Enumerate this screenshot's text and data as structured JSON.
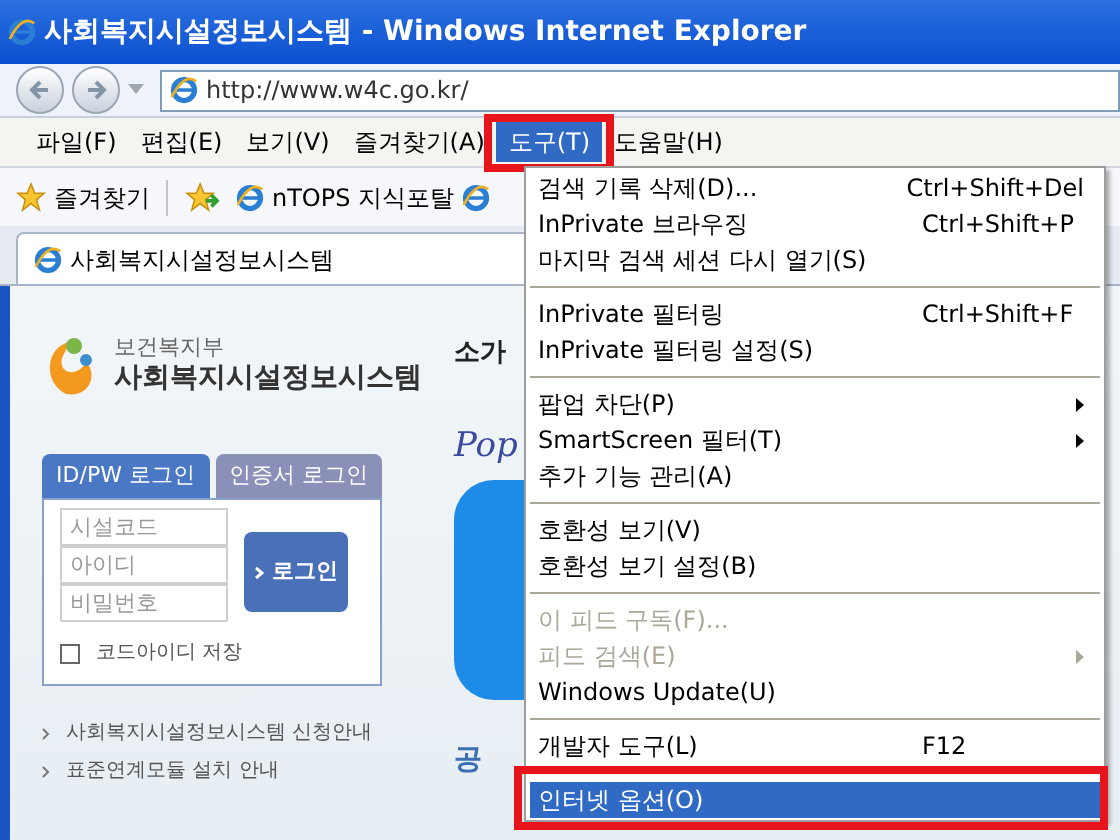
{
  "window": {
    "title": "사회복지시설정보시스템 - Windows Internet Explorer"
  },
  "address_bar": {
    "url": "http://www.w4c.go.kr/"
  },
  "menu_bar": [
    {
      "label": "파일(F)",
      "selected": false,
      "annotated": false
    },
    {
      "label": "편집(E)",
      "selected": false,
      "annotated": false
    },
    {
      "label": "보기(V)",
      "selected": false,
      "annotated": false
    },
    {
      "label": "즐겨찾기(A)",
      "selected": false,
      "annotated": false
    },
    {
      "label": "도구(T)",
      "selected": true,
      "annotated": true
    },
    {
      "label": "도움말(H)",
      "selected": false,
      "annotated": false
    }
  ],
  "favorites_bar": {
    "favorites_button": "즐겨찾기",
    "links": [
      "nTOPS 지식포탈"
    ]
  },
  "tab": {
    "title": "사회복지시설정보시스템"
  },
  "page": {
    "ministry": "보건복지부",
    "site_name": "사회복지시설정보시스템",
    "login": {
      "tabs": [
        {
          "label": "ID/PW 로그인",
          "selected": true
        },
        {
          "label": "인증서 로그인",
          "selected": false
        }
      ],
      "fields": [
        {
          "placeholder": "시설코드"
        },
        {
          "placeholder": "아이디"
        },
        {
          "placeholder": "비밀번호"
        }
      ],
      "button": "로그인",
      "remember": {
        "label": "코드아이디 저장",
        "checked": false
      }
    },
    "links": [
      "사회복지시설정보시스템 신청안내",
      "표준연계모듈 설치 안내"
    ],
    "heading_partial": "소가",
    "popup_partial": "Pop",
    "notice_partial": "공"
  },
  "tools_menu": {
    "groups": [
      [
        {
          "label": "검색 기록 삭제(D)...",
          "shortcut": "Ctrl+Shift+Del",
          "disabled": false,
          "submenu": false,
          "selected": false,
          "annotated": false
        },
        {
          "label": "InPrivate 브라우징",
          "shortcut": "Ctrl+Shift+P",
          "disabled": false,
          "submenu": false,
          "selected": false,
          "annotated": false
        },
        {
          "label": "마지막 검색 세션 다시 열기(S)",
          "disabled": false,
          "submenu": false,
          "selected": false,
          "annotated": false
        }
      ],
      [
        {
          "label": "InPrivate 필터링",
          "shortcut": "Ctrl+Shift+F",
          "disabled": false,
          "submenu": false,
          "selected": false,
          "annotated": false
        },
        {
          "label": "InPrivate 필터링 설정(S)",
          "disabled": false,
          "submenu": false,
          "selected": false,
          "annotated": false
        }
      ],
      [
        {
          "label": "팝업 차단(P)",
          "disabled": false,
          "submenu": true,
          "selected": false,
          "annotated": false
        },
        {
          "label": "SmartScreen 필터(T)",
          "disabled": false,
          "submenu": true,
          "selected": false,
          "annotated": false
        },
        {
          "label": "추가 기능 관리(A)",
          "disabled": false,
          "submenu": false,
          "selected": false,
          "annotated": false
        }
      ],
      [
        {
          "label": "호환성 보기(V)",
          "disabled": false,
          "submenu": false,
          "selected": false,
          "annotated": false
        },
        {
          "label": "호환성 보기 설정(B)",
          "disabled": false,
          "submenu": false,
          "selected": false,
          "annotated": false
        }
      ],
      [
        {
          "label": "이 피드 구독(F)...",
          "disabled": true,
          "submenu": false,
          "selected": false,
          "annotated": false
        },
        {
          "label": "피드 검색(E)",
          "disabled": true,
          "submenu": true,
          "selected": false,
          "annotated": false
        },
        {
          "label": "Windows Update(U)",
          "disabled": false,
          "submenu": false,
          "selected": false,
          "annotated": false
        }
      ],
      [
        {
          "label": "개발자 도구(L)",
          "shortcut": "F12",
          "disabled": false,
          "submenu": false,
          "selected": false,
          "annotated": false
        }
      ],
      [
        {
          "label": "인터넷 옵션(O)",
          "disabled": false,
          "submenu": false,
          "selected": true,
          "annotated": true
        }
      ]
    ]
  }
}
